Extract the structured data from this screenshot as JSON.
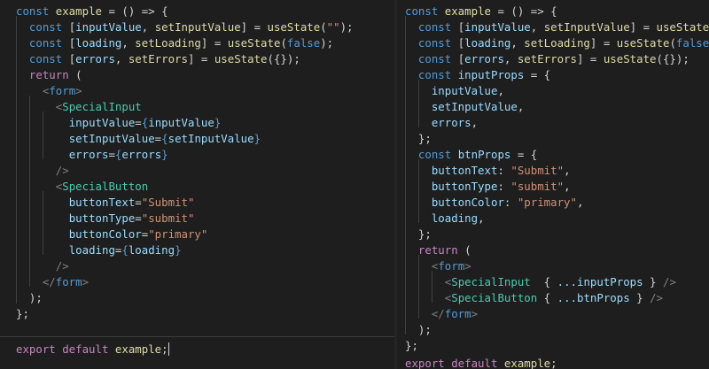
{
  "colors": {
    "background": "#1e1e1e",
    "keyword": "#c586c0",
    "storage": "#569cd6",
    "variable": "#9cdcfe",
    "function": "#dcdcaa",
    "component": "#4ec9b0",
    "string": "#ce9178",
    "punctuation": "#d4d4d4",
    "tag_bracket": "#808080"
  },
  "editors": [
    {
      "lines": [
        [
          [
            "const ",
            "storage"
          ],
          [
            "example",
            "function"
          ],
          [
            " = () => {",
            "punctuation"
          ]
        ],
        [
          [
            "  ",
            ""
          ],
          [
            "const ",
            "storage"
          ],
          [
            "[",
            "punctuation"
          ],
          [
            "inputValue",
            "variable"
          ],
          [
            ", ",
            "punctuation"
          ],
          [
            "setInputValue",
            "function"
          ],
          [
            "] = ",
            "punctuation"
          ],
          [
            "useState",
            "function"
          ],
          [
            "(",
            "punctuation"
          ],
          [
            "\"\"",
            "string"
          ],
          [
            ");",
            "punctuation"
          ]
        ],
        [
          [
            "  ",
            ""
          ],
          [
            "const ",
            "storage"
          ],
          [
            "[",
            "punctuation"
          ],
          [
            "loading",
            "variable"
          ],
          [
            ", ",
            "punctuation"
          ],
          [
            "setLoading",
            "function"
          ],
          [
            "] = ",
            "punctuation"
          ],
          [
            "useState",
            "function"
          ],
          [
            "(",
            "punctuation"
          ],
          [
            "false",
            "storage"
          ],
          [
            ");",
            "punctuation"
          ]
        ],
        [
          [
            "  ",
            ""
          ],
          [
            "const ",
            "storage"
          ],
          [
            "[",
            "punctuation"
          ],
          [
            "errors",
            "variable"
          ],
          [
            ", ",
            "punctuation"
          ],
          [
            "setErrors",
            "function"
          ],
          [
            "] = ",
            "punctuation"
          ],
          [
            "useState",
            "function"
          ],
          [
            "({});",
            "punctuation"
          ]
        ],
        [
          [
            "  ",
            ""
          ],
          [
            "return",
            "keyword"
          ],
          [
            " (",
            "punctuation"
          ]
        ],
        [
          [
            "    ",
            ""
          ],
          [
            "<",
            "tag_bracket"
          ],
          [
            "form",
            "storage"
          ],
          [
            ">",
            "tag_bracket"
          ]
        ],
        [
          [
            "      ",
            ""
          ],
          [
            "<",
            "tag_bracket"
          ],
          [
            "SpecialInput",
            "component"
          ]
        ],
        [
          [
            "        ",
            ""
          ],
          [
            "inputValue",
            "variable"
          ],
          [
            "=",
            "punctuation"
          ],
          [
            "{",
            "storage"
          ],
          [
            "inputValue",
            "variable"
          ],
          [
            "}",
            "storage"
          ]
        ],
        [
          [
            "        ",
            ""
          ],
          [
            "setInputValue",
            "variable"
          ],
          [
            "=",
            "punctuation"
          ],
          [
            "{",
            "storage"
          ],
          [
            "setInputValue",
            "variable"
          ],
          [
            "}",
            "storage"
          ]
        ],
        [
          [
            "        ",
            ""
          ],
          [
            "errors",
            "variable"
          ],
          [
            "=",
            "punctuation"
          ],
          [
            "{",
            "storage"
          ],
          [
            "errors",
            "variable"
          ],
          [
            "}",
            "storage"
          ]
        ],
        [
          [
            "      ",
            ""
          ],
          [
            "/>",
            "tag_bracket"
          ]
        ],
        [
          [
            "      ",
            ""
          ],
          [
            "<",
            "tag_bracket"
          ],
          [
            "SpecialButton",
            "component"
          ]
        ],
        [
          [
            "        ",
            ""
          ],
          [
            "buttonText",
            "variable"
          ],
          [
            "=",
            "punctuation"
          ],
          [
            "\"Submit\"",
            "string"
          ]
        ],
        [
          [
            "        ",
            ""
          ],
          [
            "buttonType",
            "variable"
          ],
          [
            "=",
            "punctuation"
          ],
          [
            "\"submit\"",
            "string"
          ]
        ],
        [
          [
            "        ",
            ""
          ],
          [
            "buttonColor",
            "variable"
          ],
          [
            "=",
            "punctuation"
          ],
          [
            "\"primary\"",
            "string"
          ]
        ],
        [
          [
            "        ",
            ""
          ],
          [
            "loading",
            "variable"
          ],
          [
            "=",
            "punctuation"
          ],
          [
            "{",
            "storage"
          ],
          [
            "loading",
            "variable"
          ],
          [
            "}",
            "storage"
          ]
        ],
        [
          [
            "      ",
            ""
          ],
          [
            "/>",
            "tag_bracket"
          ]
        ],
        [
          [
            "    ",
            ""
          ],
          [
            "</",
            "tag_bracket"
          ],
          [
            "form",
            "storage"
          ],
          [
            ">",
            "tag_bracket"
          ]
        ],
        [
          [
            "  );",
            "punctuation"
          ]
        ],
        [
          [
            "};",
            "punctuation"
          ]
        ],
        [],
        [
          [
            "export ",
            "keyword"
          ],
          [
            "default ",
            "keyword"
          ],
          [
            "example",
            "function"
          ],
          [
            ";",
            "punctuation"
          ]
        ]
      ]
    },
    {
      "lines": [
        [
          [
            "const ",
            "storage"
          ],
          [
            "example",
            "function"
          ],
          [
            " = () => {",
            "punctuation"
          ]
        ],
        [
          [
            "  ",
            ""
          ],
          [
            "const ",
            "storage"
          ],
          [
            "[",
            "punctuation"
          ],
          [
            "inputValue",
            "variable"
          ],
          [
            ", ",
            "punctuation"
          ],
          [
            "setInputValue",
            "function"
          ],
          [
            "] = ",
            "punctuation"
          ],
          [
            "useState",
            "function"
          ],
          [
            "(",
            "punctuation"
          ],
          [
            "\"\"",
            "string"
          ],
          [
            ")",
            "punctuation"
          ]
        ],
        [
          [
            "  ",
            ""
          ],
          [
            "const ",
            "storage"
          ],
          [
            "[",
            "punctuation"
          ],
          [
            "loading",
            "variable"
          ],
          [
            ", ",
            "punctuation"
          ],
          [
            "setLoading",
            "function"
          ],
          [
            "] = ",
            "punctuation"
          ],
          [
            "useState",
            "function"
          ],
          [
            "(",
            "punctuation"
          ],
          [
            "false",
            "storage"
          ],
          [
            ");",
            "punctuation"
          ]
        ],
        [
          [
            "  ",
            ""
          ],
          [
            "const ",
            "storage"
          ],
          [
            "[",
            "punctuation"
          ],
          [
            "errors",
            "variable"
          ],
          [
            ", ",
            "punctuation"
          ],
          [
            "setErrors",
            "function"
          ],
          [
            "] = ",
            "punctuation"
          ],
          [
            "useState",
            "function"
          ],
          [
            "({});",
            "punctuation"
          ]
        ],
        [
          [
            "  ",
            ""
          ],
          [
            "const ",
            "storage"
          ],
          [
            "inputProps",
            "variable"
          ],
          [
            " = {",
            "punctuation"
          ]
        ],
        [
          [
            "    ",
            ""
          ],
          [
            "inputValue",
            "variable"
          ],
          [
            ",",
            "punctuation"
          ]
        ],
        [
          [
            "    ",
            ""
          ],
          [
            "setInputValue",
            "variable"
          ],
          [
            ",",
            "punctuation"
          ]
        ],
        [
          [
            "    ",
            ""
          ],
          [
            "errors",
            "variable"
          ],
          [
            ",",
            "punctuation"
          ]
        ],
        [
          [
            "  };",
            "punctuation"
          ]
        ],
        [
          [
            "  ",
            ""
          ],
          [
            "const ",
            "storage"
          ],
          [
            "btnProps",
            "variable"
          ],
          [
            " = {",
            "punctuation"
          ]
        ],
        [
          [
            "    ",
            ""
          ],
          [
            "buttonText",
            "variable"
          ],
          [
            ": ",
            "punctuation"
          ],
          [
            "\"Submit\"",
            "string"
          ],
          [
            ",",
            "punctuation"
          ]
        ],
        [
          [
            "    ",
            ""
          ],
          [
            "buttonType",
            "variable"
          ],
          [
            ": ",
            "punctuation"
          ],
          [
            "\"submit\"",
            "string"
          ],
          [
            ",",
            "punctuation"
          ]
        ],
        [
          [
            "    ",
            ""
          ],
          [
            "buttonColor",
            "variable"
          ],
          [
            ": ",
            "punctuation"
          ],
          [
            "\"primary\"",
            "string"
          ],
          [
            ",",
            "punctuation"
          ]
        ],
        [
          [
            "    ",
            ""
          ],
          [
            "loading",
            "variable"
          ],
          [
            ",",
            "punctuation"
          ]
        ],
        [
          [
            "  };",
            "punctuation"
          ]
        ],
        [
          [
            "  ",
            ""
          ],
          [
            "return",
            "keyword"
          ],
          [
            " (",
            "punctuation"
          ]
        ],
        [
          [
            "    ",
            ""
          ],
          [
            "<",
            "tag_bracket"
          ],
          [
            "form",
            "storage"
          ],
          [
            ">",
            "tag_bracket"
          ]
        ],
        [
          [
            "      ",
            ""
          ],
          [
            "<",
            "tag_bracket"
          ],
          [
            "SpecialInput",
            "component"
          ],
          [
            "  { ",
            "punctuation"
          ],
          [
            "...inputProps",
            "variable"
          ],
          [
            " } ",
            "punctuation"
          ],
          [
            "/>",
            "tag_bracket"
          ]
        ],
        [
          [
            "      ",
            ""
          ],
          [
            "<",
            "tag_bracket"
          ],
          [
            "SpecialButton",
            "component"
          ],
          [
            " { ",
            "punctuation"
          ],
          [
            "...btnProps",
            "variable"
          ],
          [
            " } ",
            "punctuation"
          ],
          [
            "/>",
            "tag_bracket"
          ]
        ],
        [
          [
            "    ",
            ""
          ],
          [
            "</",
            "tag_bracket"
          ],
          [
            "form",
            "storage"
          ],
          [
            ">",
            "tag_bracket"
          ]
        ],
        [
          [
            "  );",
            "punctuation"
          ]
        ],
        [
          [
            "};",
            "punctuation"
          ]
        ],
        [],
        [
          [
            "export ",
            "keyword"
          ],
          [
            "default ",
            "keyword"
          ],
          [
            "example",
            "function"
          ],
          [
            ";",
            "punctuation"
          ]
        ]
      ]
    }
  ]
}
